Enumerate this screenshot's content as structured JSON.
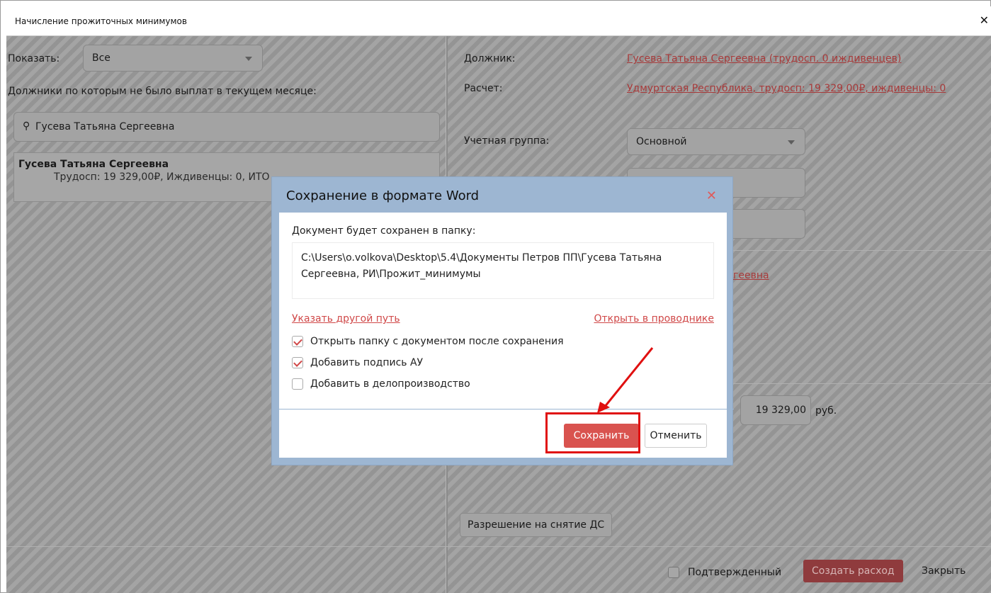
{
  "window": {
    "title": "Начисление прожиточных минимумов",
    "close_glyph": "✕"
  },
  "left_panel": {
    "show_label": "Показать:",
    "show_value": "Все",
    "debtors_caption": "Должники по которым не было выплат в текущем месяце:",
    "search_value": "Гусева Татьяна Сергеевна",
    "list": [
      {
        "name": "Гусева Татьяна Сергеевна",
        "details": "Трудосп: 19 329,00₽, Иждивенцы: 0, ИТО"
      }
    ]
  },
  "right_panel": {
    "debtor_label": "Должник:",
    "debtor_link": "Гусева Татьяна Сергеевна (трудосп. 0 иждивенцев)",
    "calc_label": "Расчет:",
    "calc_link": "Удмуртская Республика, трудосп: 19 329,00₽, иждивенцы: 0",
    "account_group_label": "Учетная группа:",
    "account_group_value": "Основной",
    "partial_link": "геевна",
    "amount_value": "19 329,00",
    "amount_unit": "руб.",
    "permission_button": "Разрешение на снятие ДС"
  },
  "footer": {
    "confirmed_label": "Подтвержденный",
    "create_expense_button": "Создать расход",
    "close_button": "Закрыть"
  },
  "dialog": {
    "title": "Сохранение в формате Word",
    "close_glyph": "✕",
    "folder_caption": "Документ будет сохранен в папку:",
    "path_text": "C:\\Users\\o.volkova\\Desktop\\5.4\\Документы Петров ПП\\Гусева Татьяна Сергеевна, РИ\\Прожит_минимумы",
    "other_path_link": "Указать другой путь",
    "open_explorer_link": "Открыть в проводнике",
    "options": [
      {
        "label": "Открыть папку с документом после сохранения",
        "checked": true
      },
      {
        "label": "Добавить подпись АУ",
        "checked": true
      },
      {
        "label": "Добавить в делопроизводство",
        "checked": false
      }
    ],
    "save_button": "Сохранить",
    "cancel_button": "Отменить"
  },
  "colors": {
    "accent_red": "#d9534f",
    "link_red": "#d04848",
    "dialog_frame": "#9db6d2",
    "annotation": "#e01010"
  }
}
